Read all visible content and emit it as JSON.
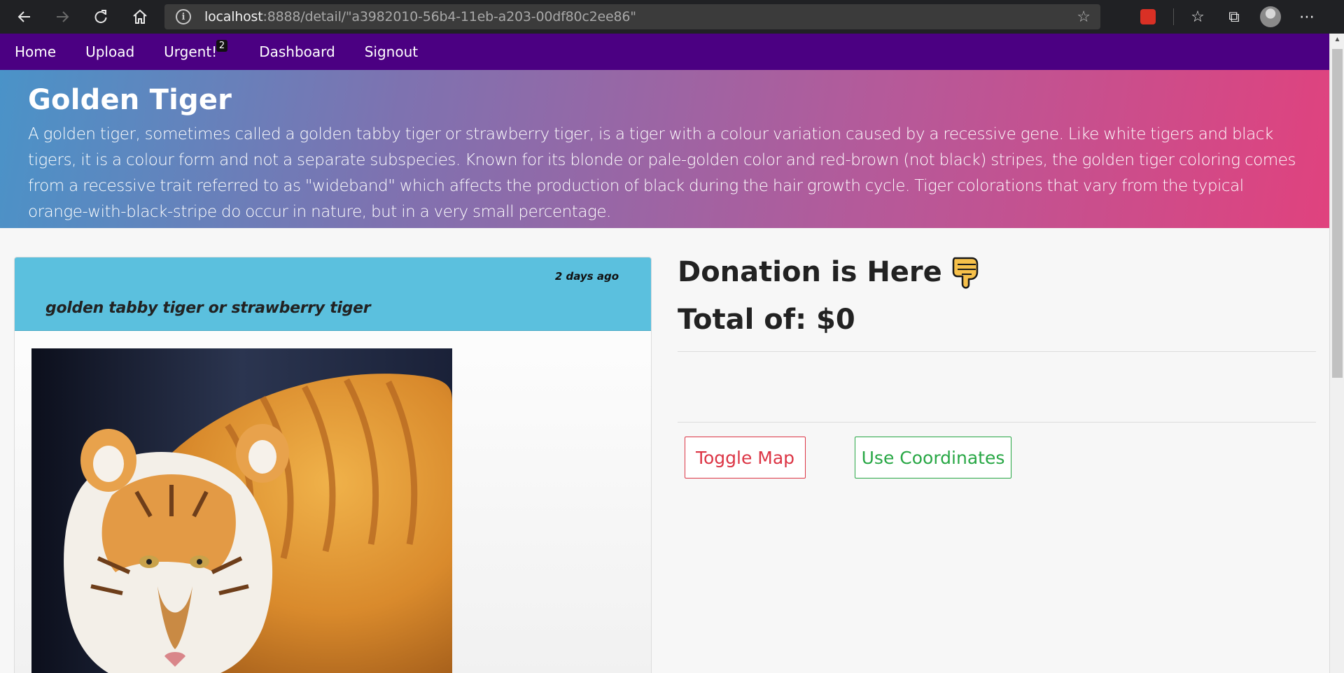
{
  "browser": {
    "url_host": "localhost",
    "url_rest": ":8888/detail/\"a3982010-56b4-11eb-a203-00df80c2ee86\""
  },
  "nav": {
    "items": [
      {
        "label": "Home"
      },
      {
        "label": "Upload"
      },
      {
        "label": "Urgent!",
        "badge": "2"
      },
      {
        "label": "Dashboard"
      },
      {
        "label": "Signout"
      }
    ]
  },
  "hero": {
    "title": "Golden Tiger",
    "description": "A golden tiger, sometimes called a golden tabby tiger or strawberry tiger, is a tiger with a colour variation caused by a recessive gene. Like white tigers and black tigers, it is a colour form and not a separate subspecies. Known for its blonde or pale-golden color and red-brown (not black) stripes, the golden tiger coloring comes from a recessive trait referred to as \"wideband\" which affects the production of black during the hair growth cycle. Tiger colorations that vary from the typical orange-with-black-stripe do occur in nature, but in a very small percentage."
  },
  "card": {
    "time": "2 days ago",
    "title": "golden tabby tiger or strawberry tiger",
    "image_icon": "tiger-photo"
  },
  "donation": {
    "heading": "Donation is Here",
    "heading_icon": "pointing-down-finger-emoji",
    "total": "Total of: $0"
  },
  "buttons": {
    "toggle_map": "Toggle Map",
    "use_coordinates": "Use Coordinates"
  },
  "colors": {
    "navbar": "#4b0082",
    "card_header": "#5bc0de",
    "danger": "#dc3545",
    "success": "#28a745"
  }
}
